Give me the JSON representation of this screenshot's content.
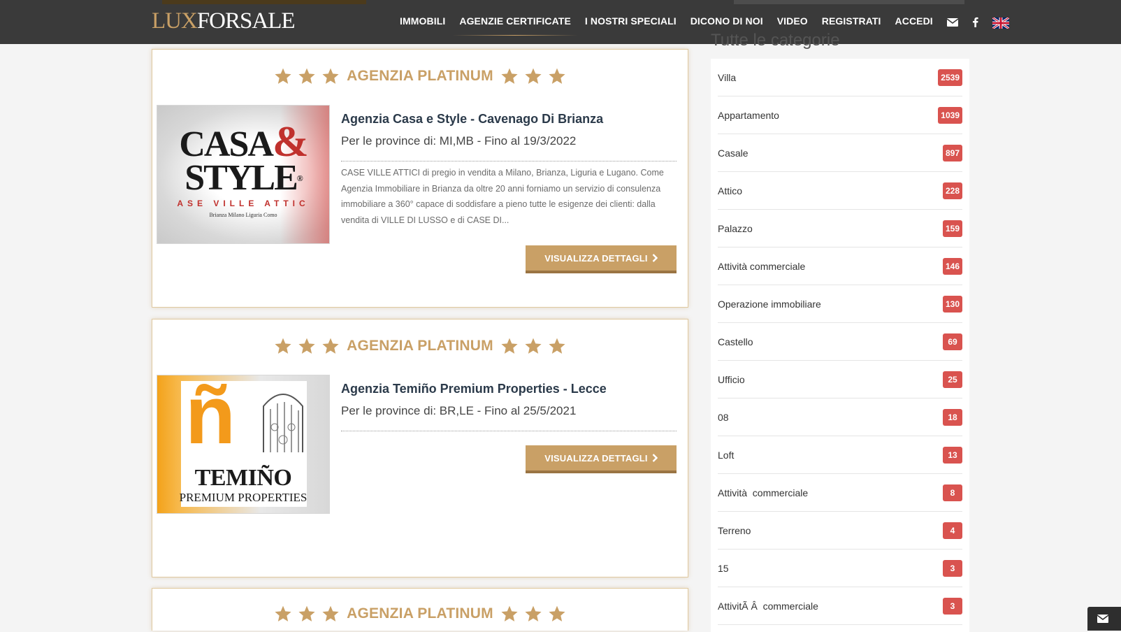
{
  "brand": {
    "logo_lux": "LUX",
    "logo_forsale": "FORSALE"
  },
  "nav": {
    "items": [
      {
        "label": "IMMOBILI",
        "active": false
      },
      {
        "label": "AGENZIE CERTIFICATE",
        "active": true
      },
      {
        "label": "I NOSTRI SPECIALI",
        "active": false
      },
      {
        "label": "DICONO DI NOI",
        "active": false
      },
      {
        "label": "VIDEO",
        "active": false
      },
      {
        "label": "REGISTRATI",
        "active": false
      },
      {
        "label": "ACCEDI",
        "active": false
      }
    ],
    "icons": [
      "envelope-icon",
      "facebook-icon",
      "uk-flag-icon"
    ]
  },
  "cards": [
    {
      "tier": "AGENZIA PLATINUM",
      "title": "Agenzia Casa e Style - Cavenago Di Brianza",
      "subtitle": "Per le province di: MI,MB - Fino al 19/3/2022",
      "description": "CASE VILLE ATTICI di pregio in vendita a Milano, Brianza, Liguria e Lugano. Come Agenzia Immobiliare in Brianza da oltre 20 anni forniamo un servizio di consulenza immobiliare a 360° capace di soddisfare a pieno tutte le esigenze dei clienti: dalla vendita di VILLE DI LUSSO e di CASE DI...",
      "button": "VISUALIZZA DETTAGLI",
      "logo": {
        "line1": "CASA",
        "amp": "&",
        "line2": "STYLE",
        "reg": "®",
        "line3": "ASE VILLE ATTIC",
        "line4": "Brianza Milano Liguria Como"
      }
    },
    {
      "tier": "AGENZIA PLATINUM",
      "title": "Agenzia Temiño Premium Properties - Lecce",
      "subtitle": "Per le province di: BR,LE - Fino al 25/5/2021",
      "description": "",
      "button": "VISUALIZZA DETTAGLI",
      "logo": {
        "glyph": "ñ",
        "name": "TEMIÑO",
        "tagline": "PREMIUM PROPERTIES"
      }
    },
    {
      "tier": "AGENZIA PLATINUM"
    }
  ],
  "sidebar": {
    "title": "Tutte le categorie",
    "categories": [
      {
        "label": "Villa",
        "count": "2539"
      },
      {
        "label": "Appartamento",
        "count": "1039"
      },
      {
        "label": "Casale",
        "count": "897"
      },
      {
        "label": "Attico",
        "count": "228"
      },
      {
        "label": "Palazzo",
        "count": "159"
      },
      {
        "label": "Attività commerciale",
        "count": "146"
      },
      {
        "label": "Operazione immobiliare",
        "count": "130"
      },
      {
        "label": "Castello",
        "count": "69"
      },
      {
        "label": "Ufficio",
        "count": "25"
      },
      {
        "label": "08",
        "count": "18"
      },
      {
        "label": "Loft",
        "count": "13"
      },
      {
        "label": "Attività  commerciale",
        "count": "8"
      },
      {
        "label": "Terreno",
        "count": "4"
      },
      {
        "label": "15",
        "count": "3"
      },
      {
        "label": "AttivitÃ Â  commerciale",
        "count": "3"
      }
    ]
  },
  "colors": {
    "gold": "#c9a066",
    "header_bg": "#3a3a3a",
    "badge": "#d9534f",
    "title_text": "#2b3a4a"
  }
}
